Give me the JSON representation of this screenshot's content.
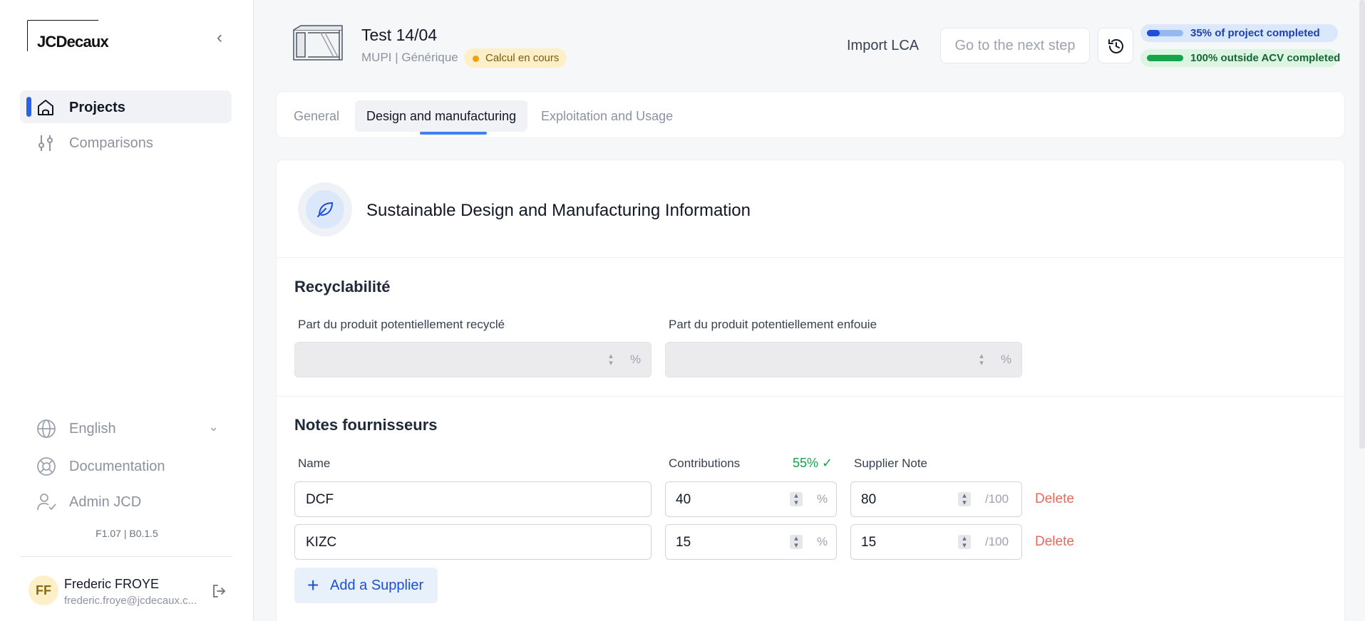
{
  "sidebar": {
    "logo": "JCDecaux",
    "nav": [
      {
        "label": "Projects",
        "icon": "home-icon"
      },
      {
        "label": "Comparisons",
        "icon": "sliders-icon"
      }
    ],
    "language": "English",
    "documentation": "Documentation",
    "admin": "Admin JCD",
    "version": "F1.07 | B0.1.5",
    "user": {
      "initials": "FF",
      "name": "Frederic FROYE",
      "email": "frederic.froye@jcdecaux.c..."
    }
  },
  "header": {
    "title": "Test 14/04",
    "subtitle": "MUPI | Générique",
    "status_badge": "Calcul en cours",
    "import_label": "Import LCA",
    "next_label": "Go to the next step",
    "progress": [
      {
        "text": "35% of project completed",
        "value": 0.35
      },
      {
        "text": "100% outside ACV completed",
        "value": 1.0
      }
    ]
  },
  "tabs": [
    "General",
    "Design and manufacturing",
    "Exploitation and Usage"
  ],
  "card": {
    "title": "Sustainable Design and Manufacturing Information",
    "recyclability": {
      "title": "Recyclabilité",
      "recycled_label": "Part du produit potentiellement recyclé",
      "buried_label": "Part du produit potentiellement enfouie",
      "unit": "%"
    },
    "suppliers": {
      "title": "Notes fournisseurs",
      "col_name": "Name",
      "col_contrib": "Contributions",
      "contrib_total": "55% ✓",
      "col_note": "Supplier Note",
      "pct_unit": "%",
      "note_unit": "/100",
      "delete_label": "Delete",
      "rows": [
        {
          "name": "DCF",
          "contribution": "40",
          "note": "80"
        },
        {
          "name": "KIZC",
          "contribution": "15",
          "note": "15"
        }
      ],
      "add_label": "Add a Supplier"
    }
  }
}
